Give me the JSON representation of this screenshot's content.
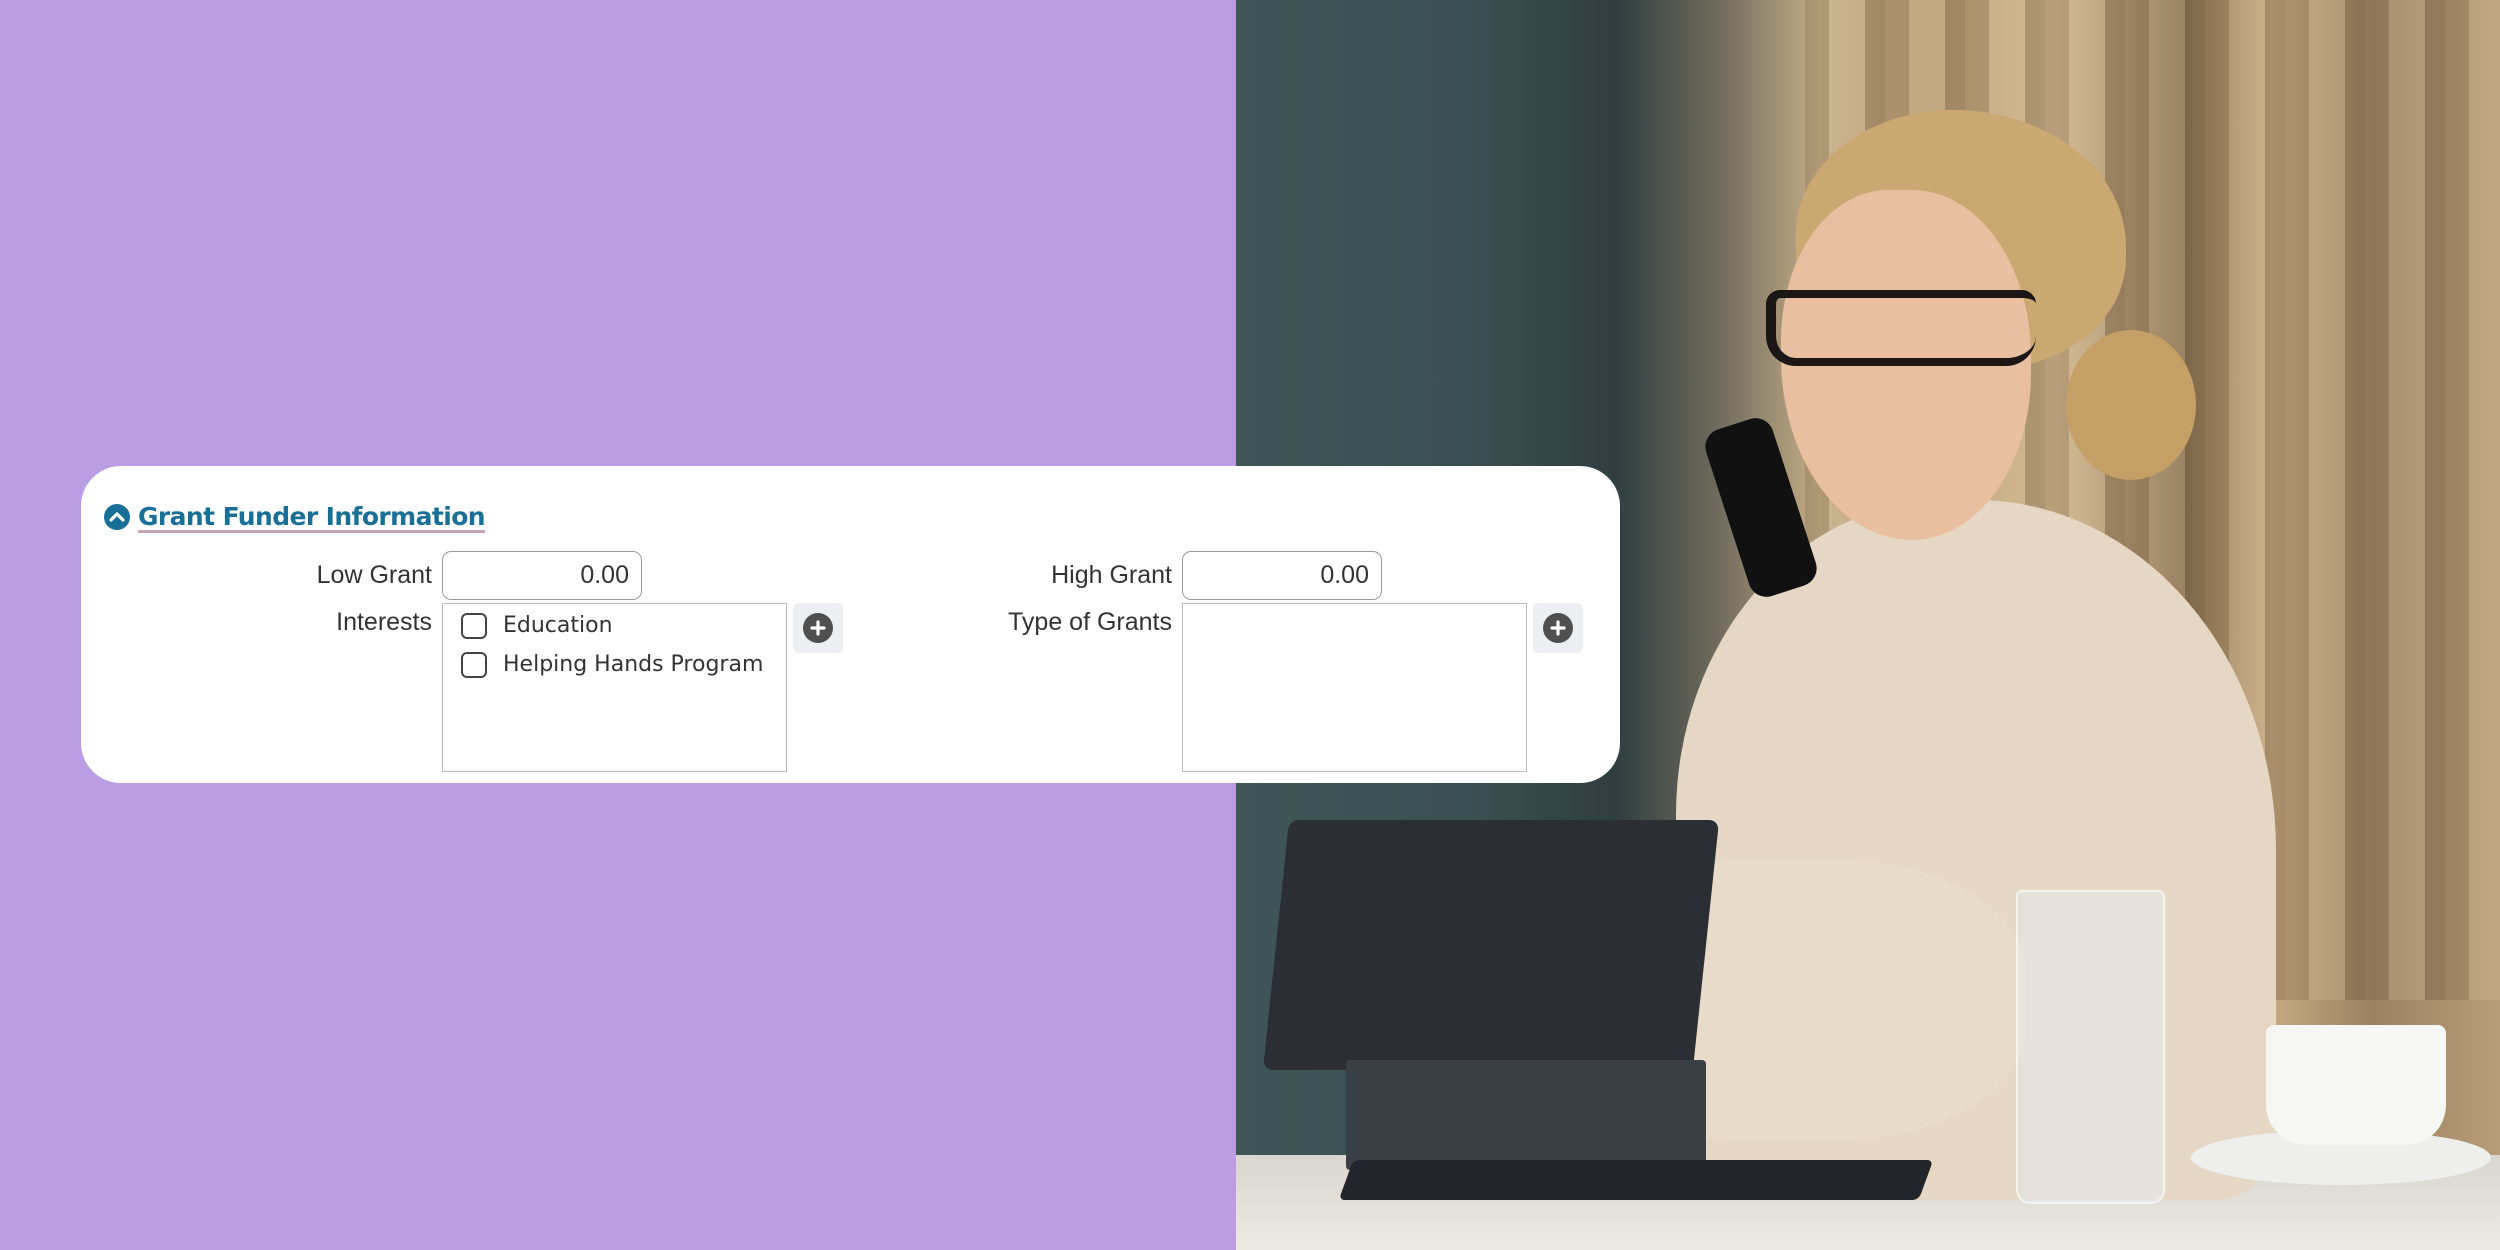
{
  "section": {
    "title": "Grant Funder Information",
    "toggle_icon": "chevron-up-circle-icon",
    "accent_color": "#1a6f96"
  },
  "fields": {
    "low_grant": {
      "label": "Low Grant",
      "value": "0.00"
    },
    "high_grant": {
      "label": "High Grant",
      "value": "0.00"
    },
    "interests": {
      "label": "Interests",
      "options": [
        {
          "label": "Education",
          "checked": false
        },
        {
          "label": "Helping Hands Program",
          "checked": false
        }
      ],
      "add_icon": "plus-circle-icon"
    },
    "type_of_grants": {
      "label": "Type of Grants",
      "options": [],
      "add_icon": "plus-circle-icon"
    }
  },
  "background": {
    "left_color": "#bb9de4",
    "photo_subject": "woman with glasses talking on phone at table with tablet, glass of water and coffee cup"
  }
}
